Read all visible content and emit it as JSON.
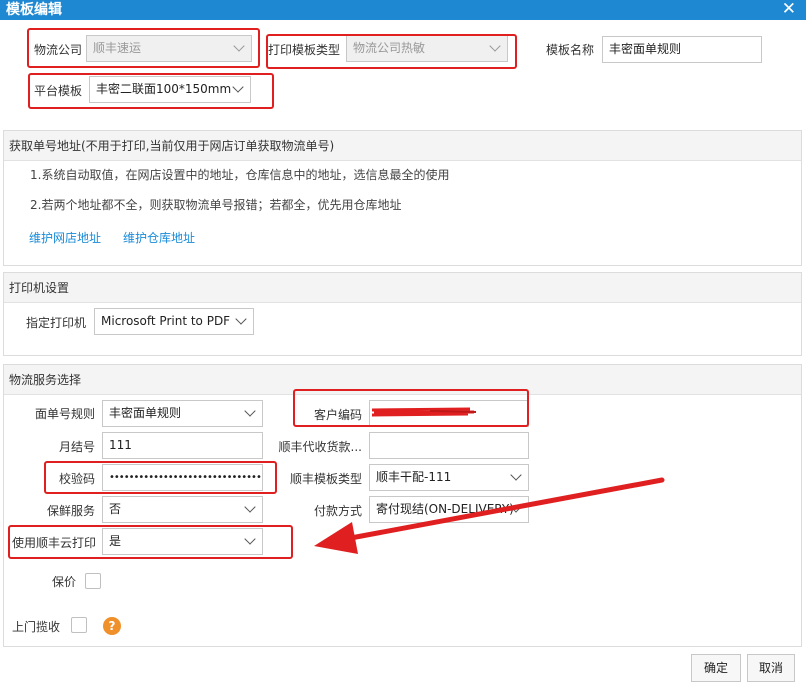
{
  "window": {
    "title": "模板编辑",
    "close_icon": "close-icon"
  },
  "top": {
    "logistics_company": {
      "label": "物流公司",
      "value": "顺丰速运"
    },
    "template_type": {
      "label": "打印模板类型",
      "value": "物流公司热敏"
    },
    "template_name": {
      "label": "模板名称",
      "value": "丰密面单规则"
    },
    "platform_template": {
      "label": "平台模板",
      "value": "丰密二联面100*150mm"
    }
  },
  "address_panel": {
    "header": "获取单号地址(不用于打印,当前仅用于网店订单获取物流单号)",
    "line1": "1.系统自动取值，在网店设置中的地址，仓库信息中的地址，选信息最全的使用",
    "line2": "2.若两个地址都不全，则获取物流单号报错；若都全，优先用仓库地址",
    "link_shop": "维护网店地址",
    "link_warehouse": "维护仓库地址"
  },
  "printer_panel": {
    "header": "打印机设置",
    "printer_label": "指定打印机",
    "printer_value": "Microsoft Print to PDF"
  },
  "service_panel": {
    "header": "物流服务选择",
    "waybill_rule": {
      "label": "面单号规则",
      "value": "丰密面单规则"
    },
    "customer_code": {
      "label": "客户编码",
      "value": ""
    },
    "monthly_account": {
      "label": "月结号",
      "value": "111"
    },
    "cod_label": "顺丰代收货款...",
    "cod_value": "",
    "checkcode": {
      "label": "校验码",
      "value": "•••••••••••••••••••••••••••••••••"
    },
    "sf_template_type": {
      "label": "顺丰模板类型",
      "value": "顺丰干配-111"
    },
    "fresh_service": {
      "label": "保鲜服务",
      "value": "否"
    },
    "payment_method": {
      "label": "付款方式",
      "value": "寄付现结(ON-DELIVERY)"
    },
    "cloud_print": {
      "label": "使用顺丰云打印",
      "value": "是"
    },
    "insured_label": "保价",
    "pickup_label": "上门揽收",
    "help_glyph": "?"
  },
  "buttons": {
    "confirm": "确定",
    "cancel": "取消"
  },
  "colors": {
    "titlebar": "#1e88d2",
    "annotation_red": "#e02020",
    "link": "#1a8bd8"
  }
}
